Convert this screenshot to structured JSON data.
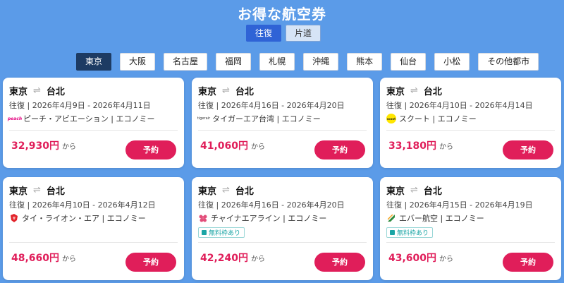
{
  "title": "お得な航空券",
  "trip_types": [
    {
      "label": "往復",
      "active": true
    },
    {
      "label": "片道",
      "active": false
    }
  ],
  "cities": [
    {
      "label": "東京",
      "active": true
    },
    {
      "label": "大阪",
      "active": false
    },
    {
      "label": "名古屋",
      "active": false
    },
    {
      "label": "福岡",
      "active": false
    },
    {
      "label": "札幌",
      "active": false
    },
    {
      "label": "沖縄",
      "active": false
    },
    {
      "label": "熊本",
      "active": false
    },
    {
      "label": "仙台",
      "active": false
    },
    {
      "label": "小松",
      "active": false
    },
    {
      "label": "その他都市",
      "active": false
    }
  ],
  "cards": [
    {
      "origin": "東京",
      "destination": "台北",
      "dates": "往復 | 2026年4月9日 - 2026年4月11日",
      "airline": "ピーチ・アビエーション | エコノミー",
      "logo_icon": "peach-logo-icon",
      "logo_text": "peach",
      "badge": "",
      "price": "32,930円",
      "price_suffix": "から",
      "book_label": "予約"
    },
    {
      "origin": "東京",
      "destination": "台北",
      "dates": "往復 | 2026年4月16日 - 2026年4月20日",
      "airline": "タイガーエア台湾 | エコノミー",
      "logo_icon": "tigerair-logo-icon",
      "logo_text": "tigerair",
      "badge": "",
      "price": "41,060円",
      "price_suffix": "から",
      "book_label": "予約"
    },
    {
      "origin": "東京",
      "destination": "台北",
      "dates": "往復 | 2026年4月10日 - 2026年4月14日",
      "airline": "スクート | エコノミー",
      "logo_icon": "scoot-logo-icon",
      "logo_text": "scoot",
      "badge": "",
      "price": "33,180円",
      "price_suffix": "から",
      "book_label": "予約"
    },
    {
      "origin": "東京",
      "destination": "台北",
      "dates": "往復 | 2026年4月10日 - 2026年4月12日",
      "airline": "タイ・ライオン・エア | エコノミー",
      "logo_icon": "lion-logo-icon",
      "logo_text": "",
      "badge": "",
      "price": "48,660円",
      "price_suffix": "から",
      "book_label": "予約"
    },
    {
      "origin": "東京",
      "destination": "台北",
      "dates": "往復 | 2026年4月16日 - 2026年4月20日",
      "airline": "チャイナエアライン | エコノミー",
      "logo_icon": "china-airlines-logo-icon",
      "logo_text": "",
      "badge": "無料枠あり",
      "price": "42,240円",
      "price_suffix": "から",
      "book_label": "予約"
    },
    {
      "origin": "東京",
      "destination": "台北",
      "dates": "往復 | 2026年4月15日 - 2026年4月19日",
      "airline": "エバー航空 | エコノミー",
      "logo_icon": "eva-air-logo-icon",
      "logo_text": "",
      "badge": "無料枠あり",
      "price": "43,600円",
      "price_suffix": "から",
      "book_label": "予約"
    }
  ],
  "colors": {
    "background": "#5b9be8",
    "accent": "#e01e5a",
    "active_trip": "#2f63d6",
    "active_city": "#1d3b63",
    "badge": "#1aa5a5"
  }
}
